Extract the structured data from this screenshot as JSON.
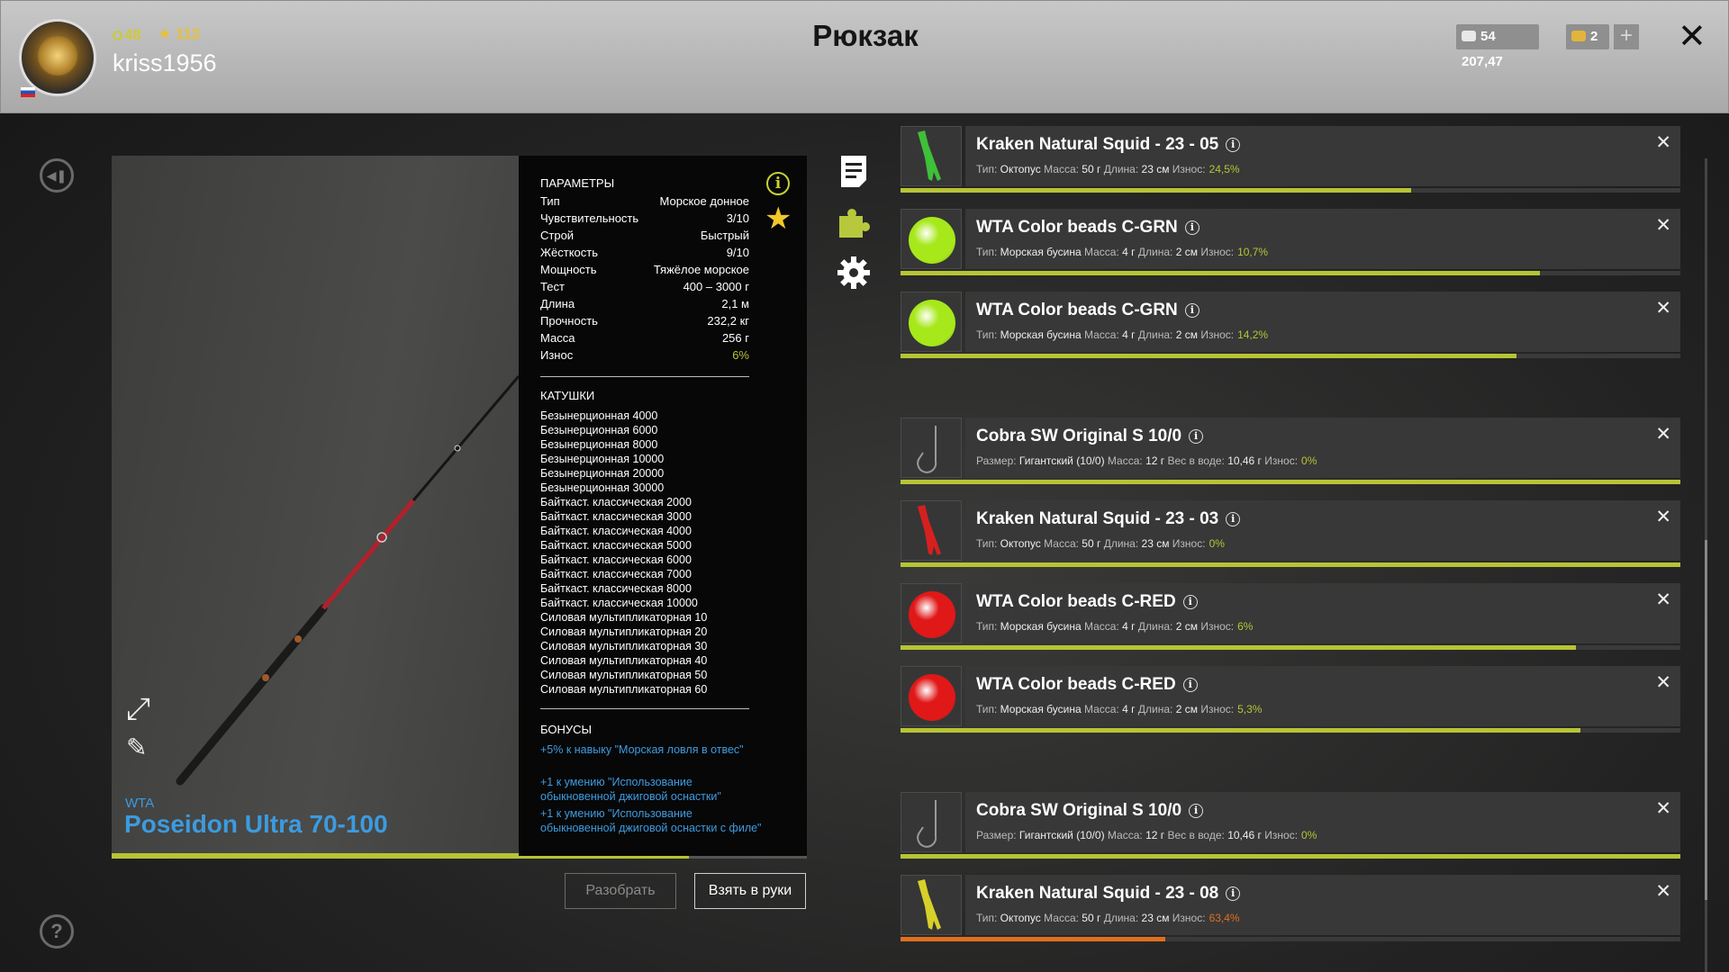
{
  "header": {
    "title": "Рюкзак",
    "username": "kriss1956",
    "level": "48",
    "stars": "112",
    "silver": "54 207,47",
    "gold": "2"
  },
  "rod": {
    "brand": "WTA",
    "name": "Poseidon Ultra 70-100",
    "wear_fraction": 0.83,
    "params_title": "ПАРАМЕТРЫ",
    "params": [
      {
        "k": "Тип",
        "v": "Морское донное"
      },
      {
        "k": "Чувствительность",
        "v": "3/10"
      },
      {
        "k": "Строй",
        "v": "Быстрый"
      },
      {
        "k": "Жёсткость",
        "v": "9/10"
      },
      {
        "k": "Мощность",
        "v": "Тяжёлое морское"
      },
      {
        "k": "Тест",
        "v": "400 – 3000 г"
      },
      {
        "k": "Длина",
        "v": "2,1 м"
      },
      {
        "k": "Прочность",
        "v": "232,2 кг"
      },
      {
        "k": "Масса",
        "v": "256 г"
      },
      {
        "k": "Износ",
        "v": "6%"
      }
    ],
    "reels_title": "КАТУШКИ",
    "reels": [
      "Безынерционная 4000",
      "Безынерционная 6000",
      "Безынерционная 8000",
      "Безынерционная 10000",
      "Безынерционная 20000",
      "Безынерционная 30000",
      "Байткаст. классическая 2000",
      "Байткаст. классическая 3000",
      "Байткаст. классическая 4000",
      "Байткаст. классическая 5000",
      "Байткаст. классическая 6000",
      "Байткаст. классическая 7000",
      "Байткаст. классическая 8000",
      "Байткаст. классическая 10000",
      "Силовая мультипликаторная 10",
      "Силовая мультипликаторная 20",
      "Силовая мультипликаторная 30",
      "Силовая мультипликаторная 40",
      "Силовая мультипликаторная 50",
      "Силовая мультипликаторная 60"
    ],
    "bonuses_title": "БОНУСЫ",
    "bonuses": [
      "+5% к навыку \"Морская ловля в отвес\"",
      "+1 к умению \"Использование обыкновенной джиговой оснастки\"",
      "+1 к умению \"Использование обыкновенной джиговой оснастки с филе\""
    ]
  },
  "buttons": {
    "disassemble": "Разобрать",
    "take": "Взять в руки"
  },
  "labels": {
    "type": "Тип:",
    "mass": "Масса:",
    "length": "Длина:",
    "wear": "Износ:",
    "size": "Размер:",
    "water_weight": "Вес в воде:"
  },
  "colors": {
    "wear_green": "#b7c435",
    "wear_orange": "#e0701e",
    "accent_blue": "#3b9be0"
  },
  "items": [
    {
      "name": "Kraken Natural Squid - 23 - 05",
      "kind": "squid",
      "color": "#3fbf3a",
      "meta": [
        [
          "Тип:",
          "Октопус"
        ],
        [
          "Масса:",
          "50 г"
        ],
        [
          "Длина:",
          "23 см"
        ]
      ],
      "wear": "24,5%",
      "wear_color": "#b7c435",
      "bar": 0.655,
      "bar_color": "#b7c435"
    },
    {
      "name": "WTA Color beads C-GRN",
      "kind": "bead",
      "color": "#a6e81a",
      "meta": [
        [
          "Тип:",
          "Морская бусина"
        ],
        [
          "Масса:",
          "4 г"
        ],
        [
          "Длина:",
          "2 см"
        ]
      ],
      "wear": "10,7%",
      "wear_color": "#b7c435",
      "bar": 0.82,
      "bar_color": "#b7c435"
    },
    {
      "name": "WTA Color beads C-GRN",
      "kind": "bead",
      "color": "#a6e81a",
      "meta": [
        [
          "Тип:",
          "Морская бусина"
        ],
        [
          "Масса:",
          "4 г"
        ],
        [
          "Длина:",
          "2 см"
        ]
      ],
      "wear": "14,2%",
      "wear_color": "#b7c435",
      "bar": 0.79,
      "bar_color": "#b7c435"
    },
    {
      "name": "Cobra SW Original S 10/0",
      "kind": "hook",
      "color": "#999999",
      "meta": [
        [
          "Размер:",
          "Гигантский (10/0)"
        ],
        [
          "Масса:",
          "12 г"
        ],
        [
          "Вес в воде:",
          "10,46 г"
        ]
      ],
      "wear": "0%",
      "wear_color": "#b7c435",
      "bar": 1.0,
      "bar_color": "#b7c435"
    },
    {
      "name": "Kraken Natural Squid - 23 - 03",
      "kind": "squid",
      "color": "#d62020",
      "meta": [
        [
          "Тип:",
          "Октопус"
        ],
        [
          "Масса:",
          "50 г"
        ],
        [
          "Длина:",
          "23 см"
        ]
      ],
      "wear": "0%",
      "wear_color": "#b7c435",
      "bar": 1.0,
      "bar_color": "#b7c435"
    },
    {
      "name": "WTA Color beads C-RED",
      "kind": "bead",
      "color": "#e01818",
      "meta": [
        [
          "Тип:",
          "Морская бусина"
        ],
        [
          "Масса:",
          "4 г"
        ],
        [
          "Длина:",
          "2 см"
        ]
      ],
      "wear": "6%",
      "wear_color": "#b7c435",
      "bar": 0.866,
      "bar_color": "#b7c435"
    },
    {
      "name": "WTA Color beads C-RED",
      "kind": "bead",
      "color": "#e01818",
      "meta": [
        [
          "Тип:",
          "Морская бусина"
        ],
        [
          "Масса:",
          "4 г"
        ],
        [
          "Длина:",
          "2 см"
        ]
      ],
      "wear": "5,3%",
      "wear_color": "#b7c435",
      "bar": 0.872,
      "bar_color": "#b7c435"
    },
    {
      "name": "Cobra SW Original S 10/0",
      "kind": "hook",
      "color": "#999999",
      "meta": [
        [
          "Размер:",
          "Гигантский (10/0)"
        ],
        [
          "Масса:",
          "12 г"
        ],
        [
          "Вес в воде:",
          "10,46 г"
        ]
      ],
      "wear": "0%",
      "wear_color": "#b7c435",
      "bar": 1.0,
      "bar_color": "#b7c435"
    },
    {
      "name": "Kraken Natural Squid - 23 - 08",
      "kind": "squid",
      "color": "#d8d02a",
      "meta": [
        [
          "Тип:",
          "Октопус"
        ],
        [
          "Масса:",
          "50 г"
        ],
        [
          "Длина:",
          "23 см"
        ]
      ],
      "wear": "63,4%",
      "wear_color": "#e0701e",
      "bar": 0.34,
      "bar_color": "#e0701e"
    }
  ]
}
